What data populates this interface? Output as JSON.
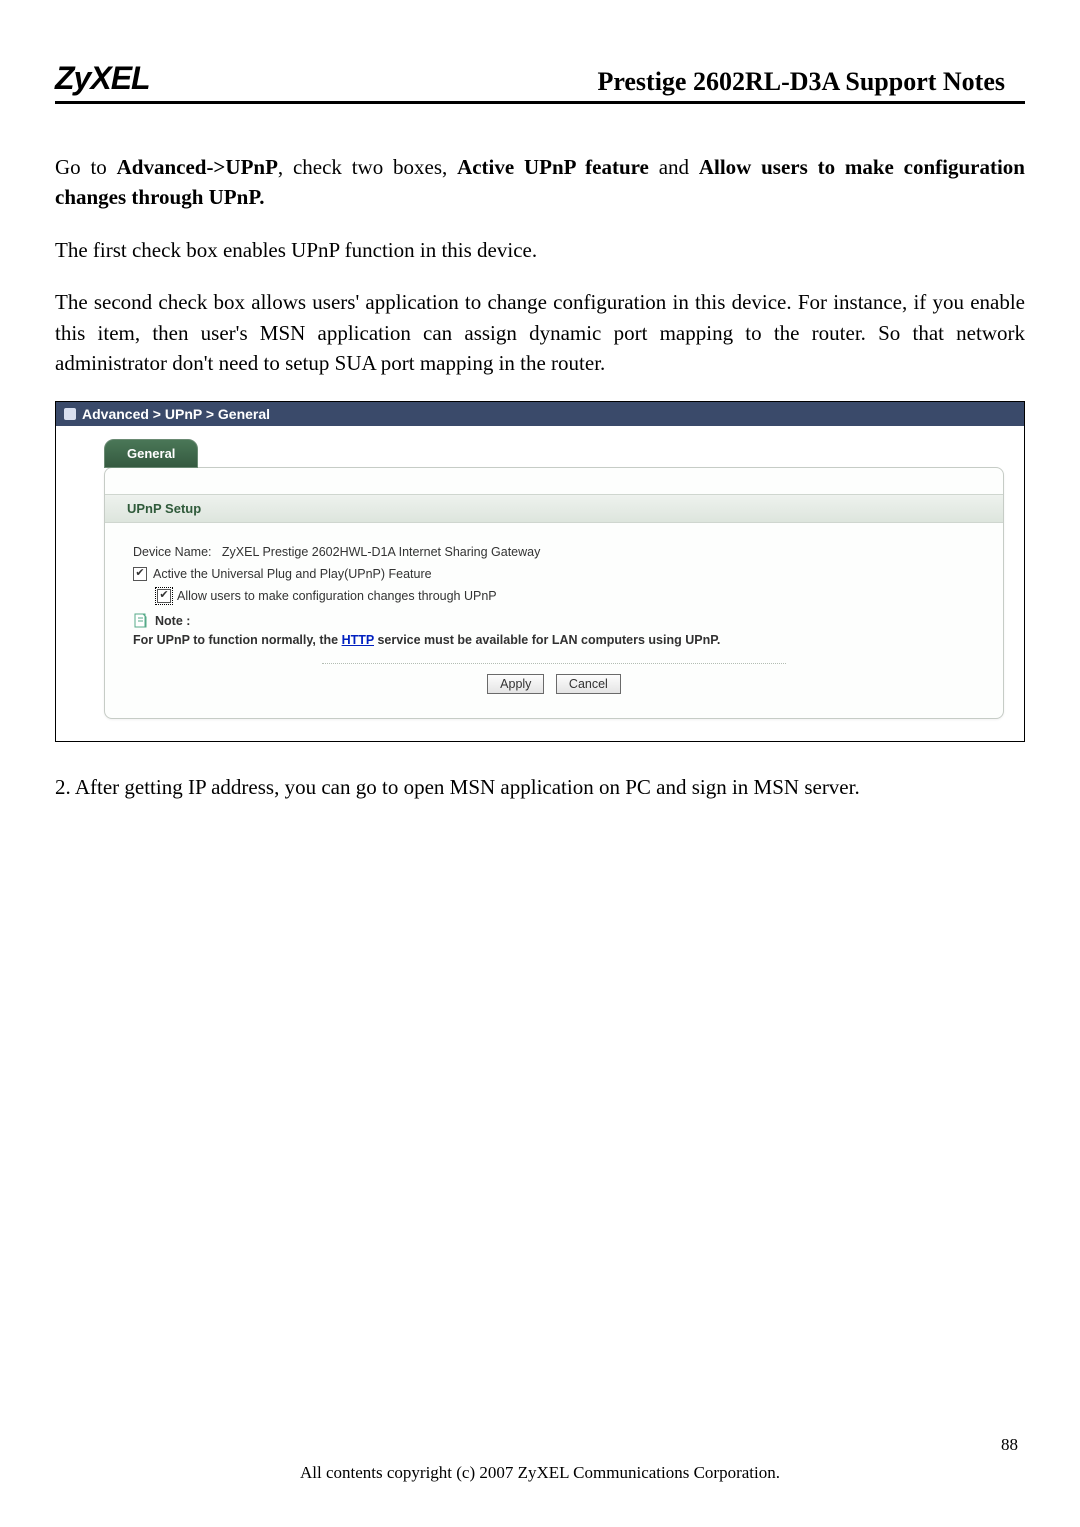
{
  "header": {
    "logo": "ZyXEL",
    "title": "Prestige 2602RL-D3A Support Notes"
  },
  "paragraphs": {
    "p1_a": "Go to ",
    "p1_b": "Advanced->UPnP",
    "p1_c": ", check two boxes, ",
    "p1_d": "Active UPnP feature",
    "p1_e": " and ",
    "p1_f": "Allow users to make configuration changes through UPnP.",
    "p2": "The first check box enables UPnP function in this device.",
    "p3": "The second check box allows users' application to change configuration in this device. For instance, if you enable this item, then user's MSN application can assign dynamic port mapping to the router. So that network administrator don't need to setup SUA port mapping in the router.",
    "p4": "2. After getting IP address, you can go to open MSN application on PC and sign in MSN server."
  },
  "ui": {
    "breadcrumb": "Advanced > UPnP > General",
    "tab": "General",
    "section": "UPnP Setup",
    "device_name_label": "Device Name:",
    "device_name_value": "ZyXEL Prestige 2602HWL-D1A Internet Sharing Gateway",
    "cb1_label": "Active the Universal Plug and Play(UPnP) Feature",
    "cb2_label": "Allow users to make configuration changes through UPnP",
    "note_label": "Note :",
    "note_body_a": "For UPnP to function normally, the ",
    "note_link": "HTTP",
    "note_body_b": " service must be available for LAN computers using UPnP.",
    "apply": "Apply",
    "cancel": "Cancel"
  },
  "footer": {
    "copyright": "All contents copyright (c) 2007 ZyXEL Communications Corporation.",
    "page": "88"
  }
}
